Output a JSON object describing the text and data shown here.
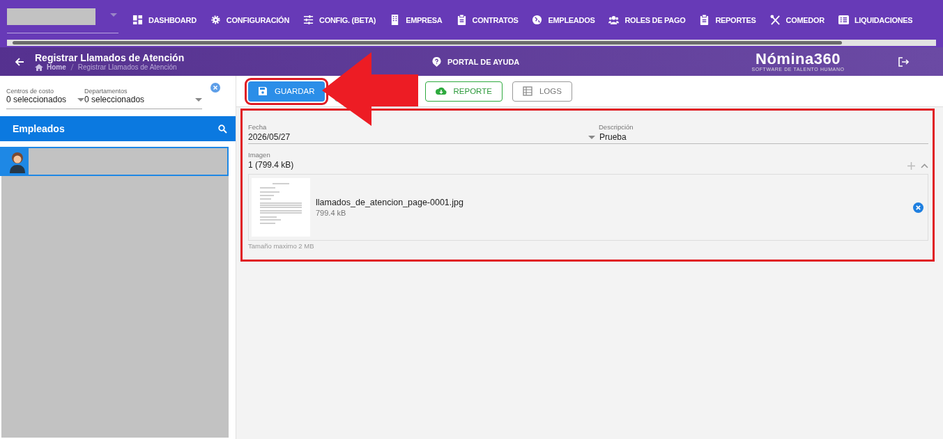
{
  "nav": [
    {
      "label": "DASHBOARD"
    },
    {
      "label": "CONFIGURACIÓN"
    },
    {
      "label": "CONFIG. (BETA)"
    },
    {
      "label": "EMPRESA"
    },
    {
      "label": "CONTRATOS"
    },
    {
      "label": "EMPLEADOS"
    },
    {
      "label": "ROLES DE PAGO"
    },
    {
      "label": "REPORTES"
    },
    {
      "label": "COMEDOR"
    },
    {
      "label": "LIQUIDACIONES"
    }
  ],
  "header": {
    "title": "Registrar Llamados de Atención",
    "breadcrumb": [
      "Home",
      "Registrar Llamados de Atención"
    ],
    "help": "PORTAL DE AYUDA",
    "logo": "Nómina360",
    "tagline": "SOFTWARE DE TALENTO HUMANO"
  },
  "filters": [
    {
      "label": "Centros de costo",
      "value": "0 seleccionados"
    },
    {
      "label": "Departamentos",
      "value": "0 seleccionados"
    }
  ],
  "employees": {
    "title": "Empleados",
    "rows": [
      {
        "selected": true
      }
    ]
  },
  "toolbar": [
    {
      "label": "GUARDAR",
      "kind": "primary"
    },
    {
      "label": "REPORTE",
      "kind": "success"
    },
    {
      "label": "LOGS",
      "kind": "neutral"
    }
  ],
  "form": {
    "fecha": {
      "label": "Fecha",
      "value": "2026/05/27"
    },
    "descripcion": {
      "label": "Descripción",
      "value": "Prueba"
    },
    "imagen": {
      "label": "Imagen",
      "value": "1 (799.4 kB)",
      "expanded": true
    },
    "files": [
      {
        "name": "llamados_de_atencion_page-0001.jpg",
        "size": "799.4 kB"
      }
    ],
    "hint": "Tamaño maximo 2 MB"
  }
}
